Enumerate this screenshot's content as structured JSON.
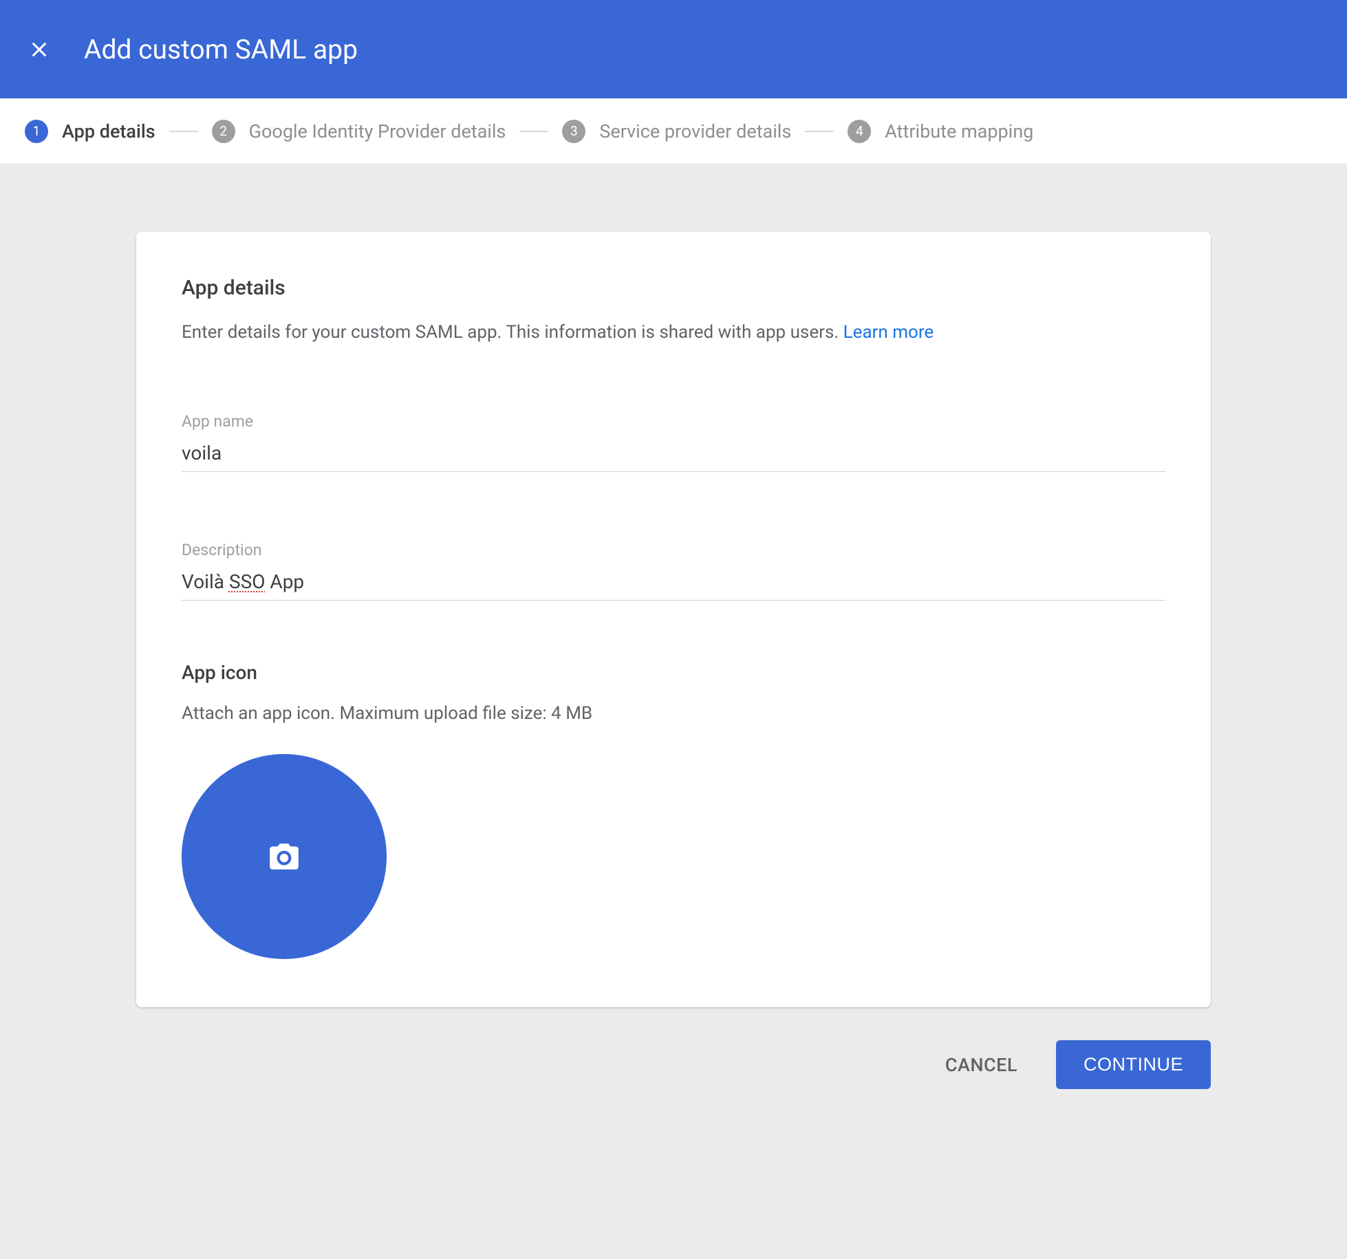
{
  "header": {
    "title": "Add custom SAML app"
  },
  "stepper": {
    "steps": [
      {
        "num": "1",
        "label": "App details"
      },
      {
        "num": "2",
        "label": "Google Identity Provider details"
      },
      {
        "num": "3",
        "label": "Service provider details"
      },
      {
        "num": "4",
        "label": "Attribute mapping"
      }
    ]
  },
  "card": {
    "title": "App details",
    "desc_text": "Enter details for your custom SAML app. This information is shared with app users. ",
    "learn_more": "Learn more",
    "fields": {
      "app_name": {
        "label": "App name",
        "value": "voila"
      },
      "description": {
        "label": "Description",
        "value_pre": "Voilà ",
        "value_spell": "SSO",
        "value_post": " App"
      }
    },
    "icon_section": {
      "title": "App icon",
      "desc": "Attach an app icon. Maximum upload file size: 4 MB"
    }
  },
  "footer": {
    "cancel": "CANCEL",
    "continue": "CONTINUE"
  }
}
